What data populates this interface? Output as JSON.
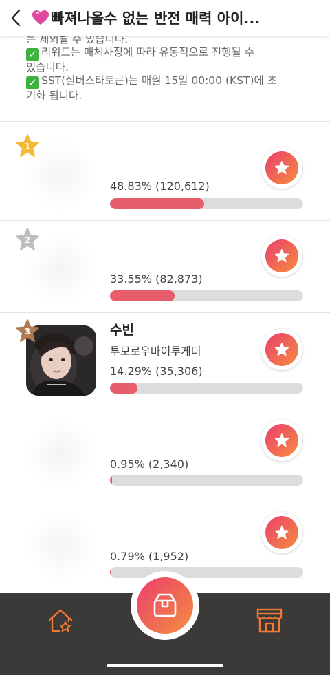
{
  "header": {
    "title": "빠져나올수 없는 반전 매력 아이...",
    "back_icon": "chevron-left-icon",
    "title_icon": "heart-icon"
  },
  "notice": {
    "line1": "는 제외될 수 있습니다.",
    "line2a": "리워드는 매체사정에 따라 유동적으로 진행될 수",
    "line2b": "있습니다.",
    "line3a": "SST(실버스타토큰)는 매월 15일 00:00 (KST)에 초",
    "line3b": "기화 됩니다.",
    "check_symbol": "✓"
  },
  "ranking": [
    {
      "rank": "1",
      "name": "",
      "group": "",
      "pct_text": "48.83% (120,612)",
      "ratio": 0.4883,
      "badge_color": "#f5b935"
    },
    {
      "rank": "2",
      "name": "",
      "group": "",
      "pct_text": "33.55% (82,873)",
      "ratio": 0.3355,
      "badge_color": "#bdbdbd"
    },
    {
      "rank": "3",
      "name": "수빈",
      "group": "투모로우바이투게더",
      "pct_text": "14.29% (35,306)",
      "ratio": 0.1429,
      "badge_color": "#b07b52"
    },
    {
      "rank": "",
      "name": "",
      "group": "",
      "pct_text": "0.95% (2,340)",
      "ratio": 0.0095,
      "badge_color": ""
    },
    {
      "rank": "",
      "name": "",
      "group": "",
      "pct_text": "0.79% (1,952)",
      "ratio": 0.0079,
      "badge_color": ""
    }
  ],
  "tabbar": {
    "left_icon": "home-star-icon",
    "center_icon": "box-icon",
    "right_icon": "store-icon",
    "accent": "#f07a35"
  }
}
